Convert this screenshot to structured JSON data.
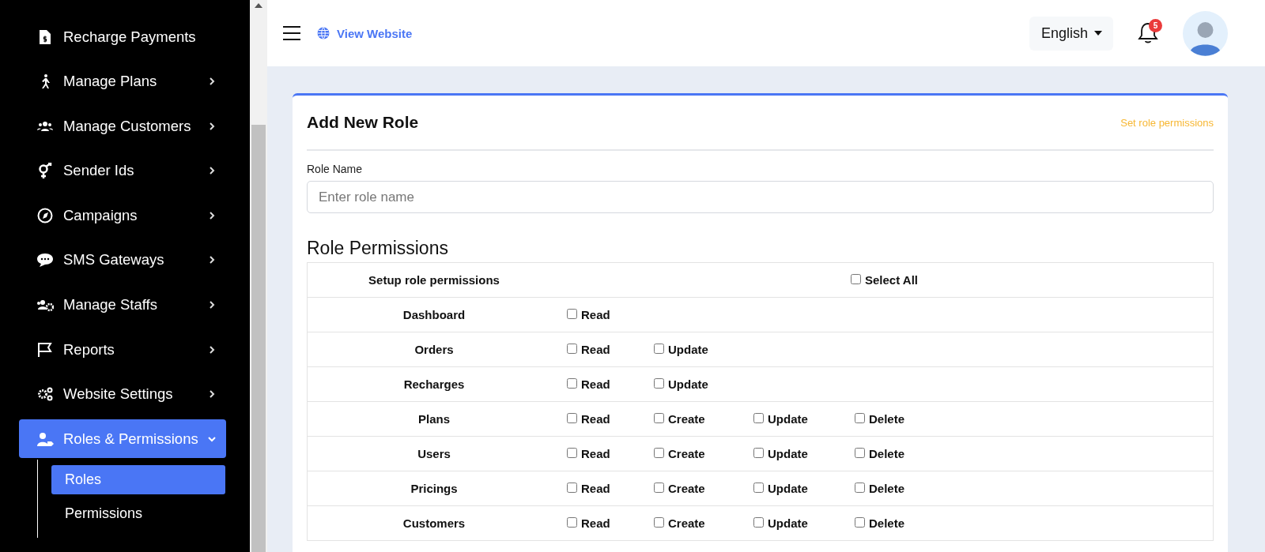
{
  "sidebar": {
    "items": [
      {
        "label": "Recharge Payments",
        "kind": "link",
        "selected": false
      },
      {
        "label": "Manage Plans",
        "kind": "group",
        "expanded": false,
        "selected": false
      },
      {
        "label": "Manage Customers",
        "kind": "group",
        "expanded": false,
        "selected": false
      },
      {
        "label": "Sender Ids",
        "kind": "group",
        "expanded": false,
        "selected": false
      },
      {
        "label": "Campaigns",
        "kind": "group",
        "expanded": false,
        "selected": false
      },
      {
        "label": "SMS Gateways",
        "kind": "group",
        "expanded": false,
        "selected": false
      },
      {
        "label": "Manage Staffs",
        "kind": "group",
        "expanded": false,
        "selected": false
      },
      {
        "label": "Reports",
        "kind": "group",
        "expanded": false,
        "selected": false
      },
      {
        "label": "Website Settings",
        "kind": "group",
        "expanded": false,
        "selected": false
      },
      {
        "label": "Roles & Permissions",
        "kind": "group",
        "expanded": true,
        "selected": true,
        "children": [
          {
            "label": "Roles",
            "selected": true
          },
          {
            "label": "Permissions",
            "selected": false
          }
        ]
      }
    ]
  },
  "header": {
    "view_website": "View Website",
    "language": "English",
    "notification_count": "5"
  },
  "card": {
    "title": "Add New Role",
    "hint": "Set role permissions",
    "role_name": {
      "label": "Role Name",
      "placeholder": "Enter role name"
    },
    "permissions_title": "Role Permissions",
    "table": {
      "header": "Setup role permissions",
      "select_all": {
        "label": "Select All",
        "checked": false
      },
      "rows": [
        {
          "module": "Dashboard",
          "permissions": [
            {
              "label": "Read",
              "checked": false
            }
          ]
        },
        {
          "module": "Orders",
          "permissions": [
            {
              "label": "Read",
              "checked": false
            },
            {
              "label": "Update",
              "checked": false
            }
          ]
        },
        {
          "module": "Recharges",
          "permissions": [
            {
              "label": "Read",
              "checked": false
            },
            {
              "label": "Update",
              "checked": false
            }
          ]
        },
        {
          "module": "Plans",
          "permissions": [
            {
              "label": "Read",
              "checked": false
            },
            {
              "label": "Create",
              "checked": false
            },
            {
              "label": "Update",
              "checked": false
            },
            {
              "label": "Delete",
              "checked": false
            }
          ]
        },
        {
          "module": "Users",
          "permissions": [
            {
              "label": "Read",
              "checked": false
            },
            {
              "label": "Create",
              "checked": false
            },
            {
              "label": "Update",
              "checked": false
            },
            {
              "label": "Delete",
              "checked": false
            }
          ]
        },
        {
          "module": "Pricings",
          "permissions": [
            {
              "label": "Read",
              "checked": false
            },
            {
              "label": "Create",
              "checked": false
            },
            {
              "label": "Update",
              "checked": false
            },
            {
              "label": "Delete",
              "checked": false
            }
          ]
        },
        {
          "module": "Customers",
          "permissions": [
            {
              "label": "Read",
              "checked": false
            },
            {
              "label": "Create",
              "checked": false
            },
            {
              "label": "Update",
              "checked": false
            },
            {
              "label": "Delete",
              "checked": false
            }
          ]
        }
      ]
    }
  }
}
